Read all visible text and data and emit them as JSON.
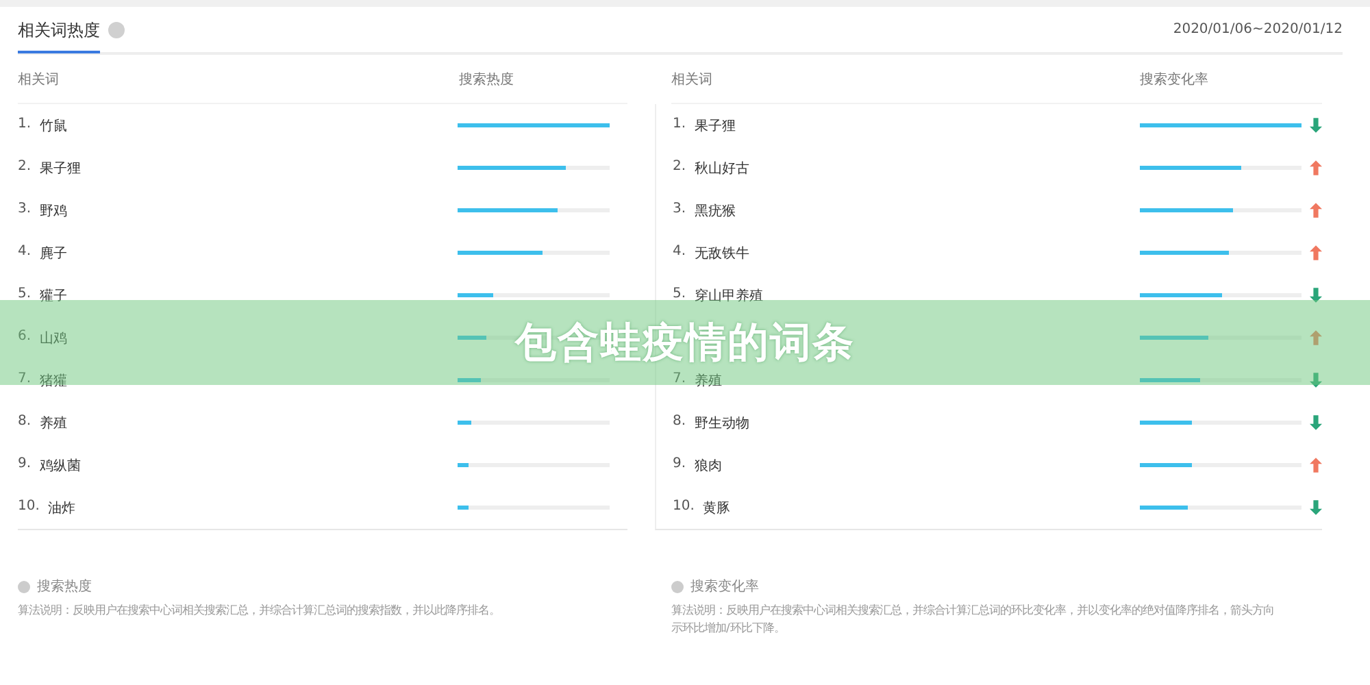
{
  "header": {
    "tab": {
      "label": "相关词热度",
      "selected": true
    },
    "date_range": "2020/01/06~2020/01/12"
  },
  "panels": [
    {
      "columns": [
        "相关词",
        "搜索热度"
      ],
      "rows": [
        {
          "rank": "1.",
          "word": "竹鼠",
          "level": 1.0
        },
        {
          "rank": "2.",
          "word": "果子狸",
          "level": 0.71
        },
        {
          "rank": "3.",
          "word": "野鸡",
          "level": 0.66
        },
        {
          "rank": "4.",
          "word": "麂子",
          "level": 0.56
        },
        {
          "rank": "5.",
          "word": "獾子",
          "level": 0.23
        },
        {
          "rank": "6.",
          "word": "山鸡",
          "level": 0.19
        },
        {
          "rank": "7.",
          "word": "猪獾",
          "level": 0.15
        },
        {
          "rank": "8.",
          "word": "养殖",
          "level": 0.09
        },
        {
          "rank": "9.",
          "word": "鸡纵菌",
          "level": 0.07
        },
        {
          "rank": "10.",
          "word": "油炸",
          "level": 0.07
        }
      ],
      "note": {
        "title": "搜索热度",
        "text": "算法说明：反映用户在搜索中心词相关搜索汇总，并综合计算汇总词的搜索指数，并以此降序排名。"
      }
    },
    {
      "columns": [
        "相关词",
        "搜索变化率"
      ],
      "rows": [
        {
          "rank": "1.",
          "word": "果子狸",
          "level": 1.0,
          "rising": false
        },
        {
          "rank": "2.",
          "word": "秋山好古",
          "level": 0.63,
          "rising": true
        },
        {
          "rank": "3.",
          "word": "黑疣猴",
          "level": 0.58,
          "rising": true
        },
        {
          "rank": "4.",
          "word": "无敌铁牛",
          "level": 0.55,
          "rising": true
        },
        {
          "rank": "5.",
          "word": "穿山甲养殖",
          "level": 0.51,
          "rising": false
        },
        {
          "level": 0.42,
          "rising": true
        },
        {
          "rank": "7.",
          "word": "养殖",
          "level": 0.37,
          "rising": false
        },
        {
          "rank": "8.",
          "word": "野生动物",
          "level": 0.32,
          "rising": false
        },
        {
          "rank": "9.",
          "word": "狼肉",
          "level": 0.32,
          "rising": true
        },
        {
          "rank": "10.",
          "word": "黄豚",
          "level": 0.3,
          "rising": false
        }
      ],
      "note": {
        "title": "搜索变化率",
        "text": "算法说明：反映用户在搜索中心词相关搜索汇总，并综合计算汇总词的环比变化率，并以变化率的绝对值降序排名，箭头方向",
        "text_2": "示环比增加/环比下降。"
      }
    }
  ],
  "banner": {
    "text": "包含蛙疫情的词条"
  }
}
